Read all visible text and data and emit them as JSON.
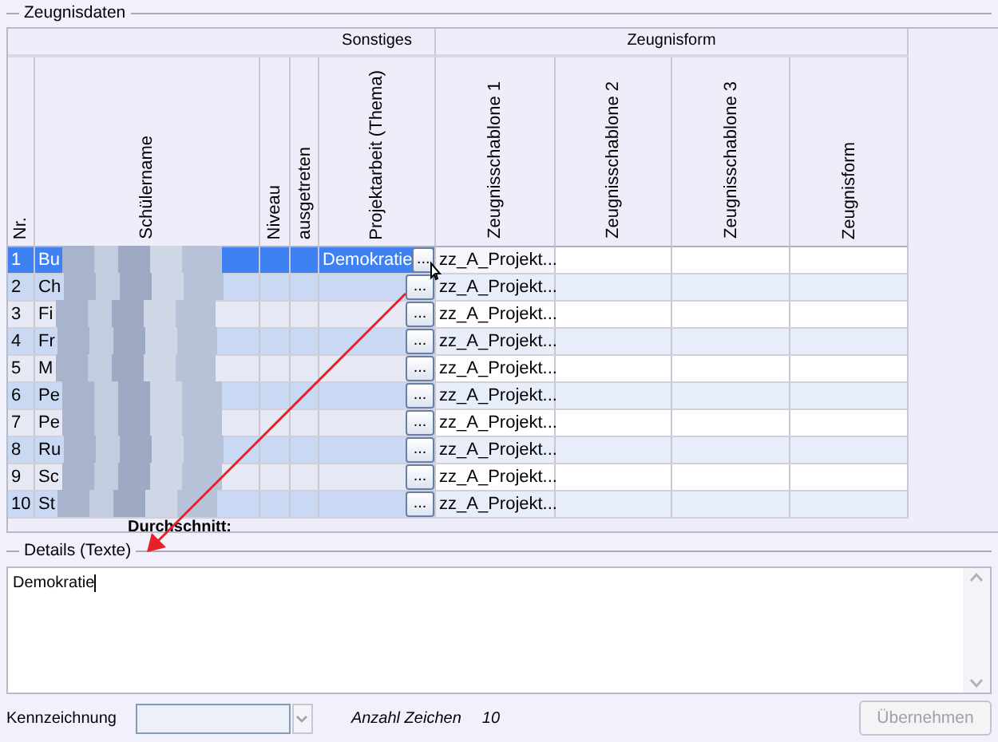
{
  "zeugnisdaten": {
    "title": "Zeugnisdaten",
    "header": [
      {
        "kind": "single",
        "label": "Nr."
      },
      {
        "kind": "single",
        "label": "Schülername"
      },
      {
        "kind": "single",
        "label": "Niveau"
      },
      {
        "kind": "single",
        "label": "ausgetreten"
      },
      {
        "kind": "group",
        "label": "Sonstiges",
        "columns": [
          {
            "label": "Projektarbeit (Thema)"
          }
        ]
      },
      {
        "kind": "group",
        "label": "Zeugnisform",
        "columns": [
          {
            "label": "Zeugnisschablone 1"
          },
          {
            "label": "Zeugnisschablone 2"
          },
          {
            "label": "Zeugnisschablone 3"
          },
          {
            "label": "Zeugnisform"
          }
        ]
      }
    ],
    "rows": [
      {
        "nr": "1",
        "name": "Bu",
        "projekt": "Demokratie",
        "button": "...",
        "vorlage_1": "zz_A_Projekt...",
        "selected": true
      },
      {
        "nr": "2",
        "name": "Ch",
        "button": "...",
        "vorlage_1": "zz_A_Projekt...",
        "selected": false
      },
      {
        "nr": "3",
        "name": "Fi",
        "button": "...",
        "vorlage_1": "zz_A_Projekt...",
        "selected": false
      },
      {
        "nr": "4",
        "name": "Fr",
        "button": "...",
        "vorlage_1": "zz_A_Projekt...",
        "selected": false
      },
      {
        "nr": "5",
        "name": "M",
        "button": "...",
        "vorlage_1": "zz_A_Projekt...",
        "selected": false
      },
      {
        "nr": "6",
        "name": "Pe",
        "button": "...",
        "vorlage_1": "zz_A_Projekt...",
        "selected": false
      },
      {
        "nr": "7",
        "name": "Pe",
        "button": "...",
        "vorlage_1": "zz_A_Projekt...",
        "selected": false
      },
      {
        "nr": "8",
        "name": "Ru",
        "button": "...",
        "vorlage_1": "zz_A_Projekt...",
        "selected": false
      },
      {
        "nr": "9",
        "name": "Sc",
        "button": "...",
        "vorlage_1": "zz_A_Projekt...",
        "selected": false
      },
      {
        "nr": "10",
        "name": "St",
        "button": "...",
        "vorlage_1": "zz_A_Projekt...",
        "selected": false
      }
    ],
    "footer": "Durchschnitt:"
  },
  "details": {
    "title": "Details (Texte)",
    "value": "Demokratie"
  },
  "bottom": {
    "kennzeichnung_label": "Kennzeichnung",
    "anzahl_label": "Anzahl Zeichen",
    "anzahl_value": "10",
    "apply_button": {
      "label": "Übernehmen",
      "disabled": true
    }
  }
}
